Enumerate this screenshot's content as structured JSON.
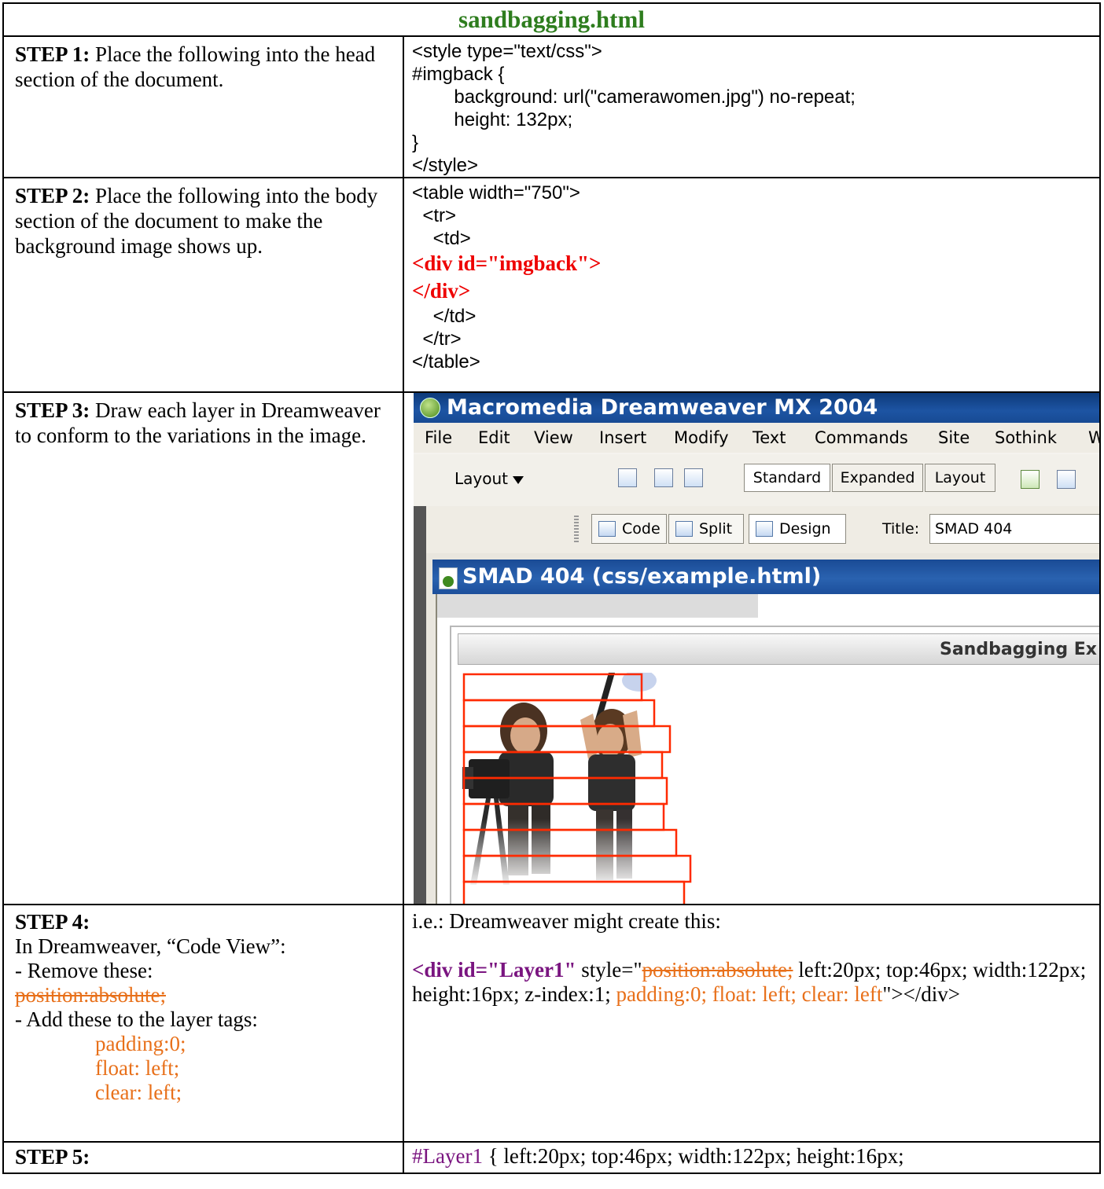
{
  "doc_title": "sandbagging.html",
  "step1": {
    "label": "STEP 1:",
    "text": " Place the following into the head section of the document.",
    "code": "<style type=\"text/css\">\n#imgback {\n\tbackground: url(\"camerawomen.jpg\") no-repeat;\n\theight: 132px;\n}\n</style>"
  },
  "step2": {
    "label": "STEP 2:",
    "text": " Place the following into the body section of the document to make the background image shows up.",
    "code_top": "<table width=\"750\">\n  <tr>\n    <td>",
    "red_open": "<div id=\"imgback\">",
    "red_close": "</div>",
    "code_bottom": "    </td>\n  </tr>\n</table>"
  },
  "step3": {
    "label": "STEP 3:",
    "text": " Draw each layer in Dreamweaver to conform to the variations in the image."
  },
  "dw": {
    "app_title": "Macromedia Dreamweaver MX 2004",
    "menu": [
      "File",
      "Edit",
      "View",
      "Insert",
      "Modify",
      "Text",
      "Commands",
      "Site",
      "Sothink",
      "W"
    ],
    "insert_category": "Layout",
    "modes": [
      "Standard",
      "Expanded",
      "Layout"
    ],
    "views": [
      "Code",
      "Split",
      "Design"
    ],
    "title_label": "Title:",
    "title_value": "SMAD 404",
    "document_title": "SMAD 404 (css/example.html)",
    "page_header": "Sandbagging Ex"
  },
  "step4": {
    "label": "STEP 4:",
    "line1": "In Dreamweaver, “Code View”:",
    "line2": "- Remove these:",
    "remove_value": "position:absolute;",
    "line3": "- Add these to the layer tags:",
    "add_values": [
      "padding:0;",
      "float: left;",
      "clear: left;"
    ],
    "example_intro": "i.e.: Dreamweaver might create this:",
    "ex_tag": "<div id=\"Layer1\"",
    "ex_style_open": " style=\"",
    "ex_removed": "position:absolute;",
    "ex_mid": " left:20px; top:46px; width:122px; height:16px; z-index:1; ",
    "ex_added": "padding:0; float: left; clear: left",
    "ex_close": "\"></div>"
  },
  "step5": {
    "label": "STEP 5:",
    "selector": "#Layer1",
    "rule": " { left:20px; top:46px; width:122px; height:16px;"
  },
  "colors": {
    "title_green": "#2e7d1e",
    "code_red": "#ee0000",
    "orange": "#e8701a",
    "purple": "#7a1580",
    "layer_outline": "#ff2a00"
  }
}
